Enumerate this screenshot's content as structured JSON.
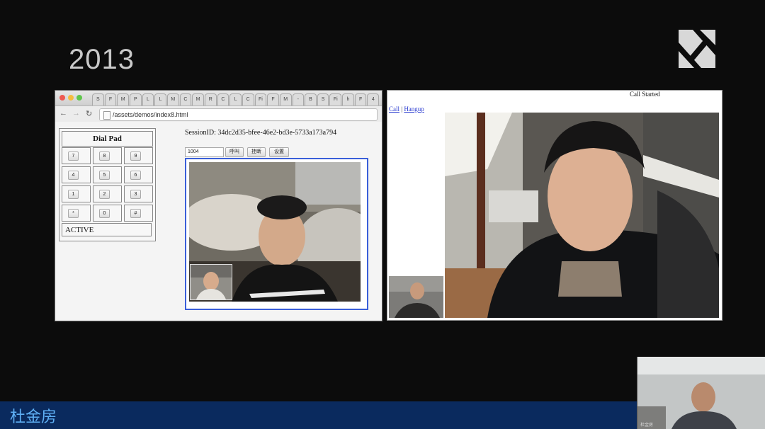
{
  "slide": {
    "year": "2013",
    "logo_icon": "x-logo-icon",
    "speaker_name": "杜金房",
    "presenter_label": "杜金房"
  },
  "browser": {
    "tabs": [
      "S",
      "F",
      "M",
      "P",
      "L",
      "L",
      "M",
      "C",
      "M",
      "R",
      "C",
      "L",
      "C",
      "Fi",
      "F",
      "M",
      "-",
      "B",
      "S",
      "Fi",
      "h",
      "F",
      "4"
    ],
    "url": "/assets/demos/index8.html",
    "dialpad": {
      "title": "Dial Pad",
      "keys": [
        "7",
        "8",
        "9",
        "4",
        "5",
        "6",
        "1",
        "2",
        "3",
        "*",
        "0",
        "#"
      ],
      "status": "ACTIVE"
    },
    "session_id": "SessionID: 34dc2d35-bfee-46e2-bd3e-5733a173a794",
    "number_value": "1004",
    "buttons": [
      "呼叫",
      "挂断",
      "设置"
    ]
  },
  "app2": {
    "call_status": "Call Started",
    "link_call": "Call",
    "separator": "|",
    "link_hangup": "Hangup"
  },
  "colors": {
    "video_border": "#3a5fd9",
    "bottom_bar": "#0a2a5e",
    "speaker_text": "#5fb0f5"
  }
}
